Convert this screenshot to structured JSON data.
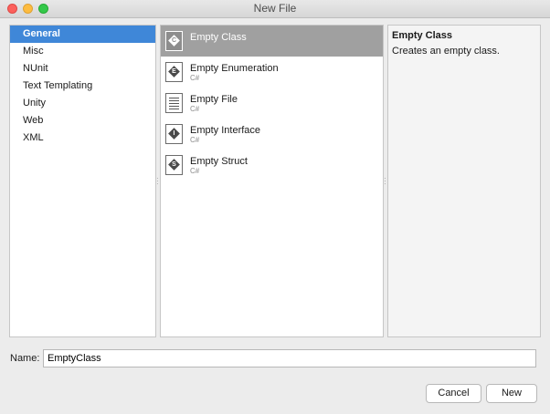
{
  "window": {
    "title": "New File"
  },
  "categories": [
    {
      "label": "General",
      "selected": true
    },
    {
      "label": "Misc",
      "selected": false
    },
    {
      "label": "NUnit",
      "selected": false
    },
    {
      "label": "Text Templating",
      "selected": false
    },
    {
      "label": "Unity",
      "selected": false
    },
    {
      "label": "Web",
      "selected": false
    },
    {
      "label": "XML",
      "selected": false
    }
  ],
  "templates": [
    {
      "name": "Empty Class",
      "sub": "",
      "icon": "class-icon",
      "selected": true
    },
    {
      "name": "Empty Enumeration",
      "sub": "C#",
      "icon": "enum-icon",
      "selected": false
    },
    {
      "name": "Empty File",
      "sub": "C#",
      "icon": "file-icon",
      "selected": false
    },
    {
      "name": "Empty Interface",
      "sub": "C#",
      "icon": "interface-icon",
      "selected": false
    },
    {
      "name": "Empty Struct",
      "sub": "C#",
      "icon": "struct-icon",
      "selected": false
    }
  ],
  "description": {
    "title": "Empty Class",
    "text": "Creates an empty class."
  },
  "name_field": {
    "label": "Name:",
    "value": "EmptyClass"
  },
  "buttons": {
    "cancel": "Cancel",
    "new": "New"
  },
  "colors": {
    "selection": "#3f87d8",
    "template_selection": "#a0a0a0"
  }
}
